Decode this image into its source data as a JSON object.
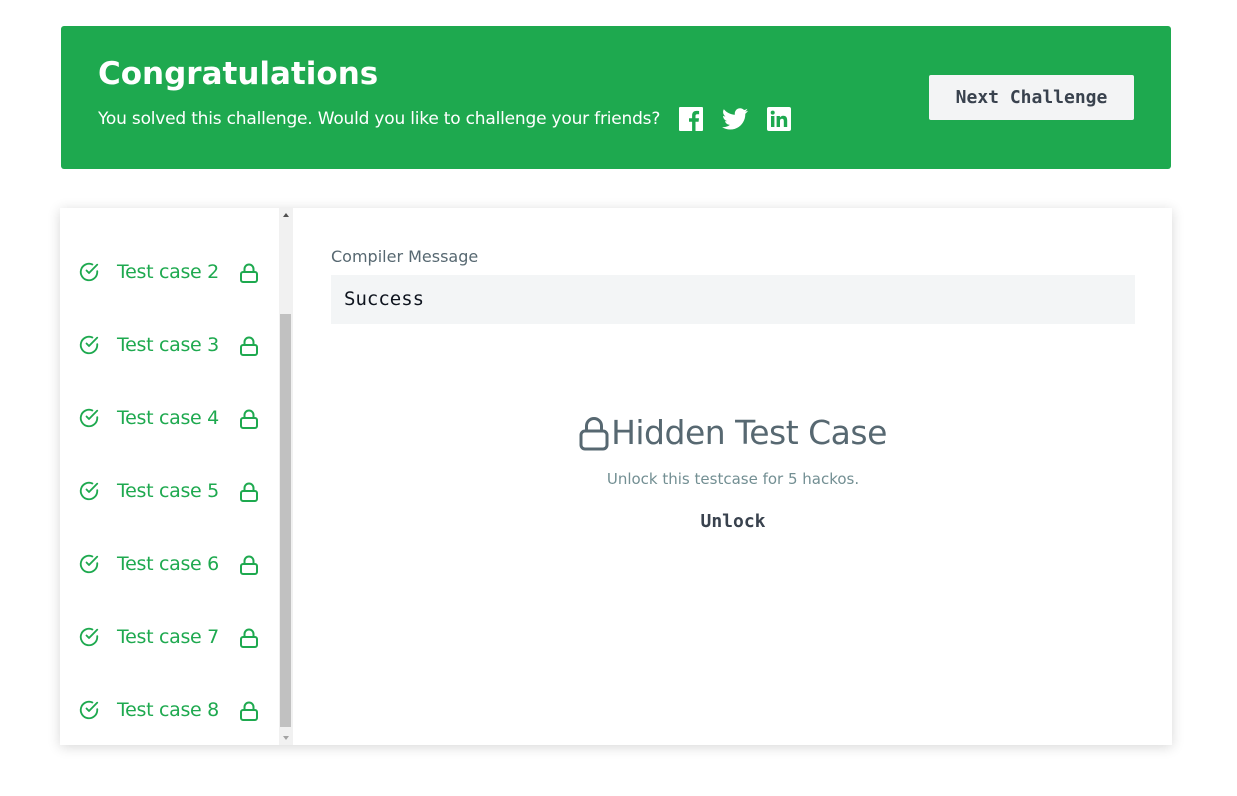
{
  "banner": {
    "title": "Congratulations",
    "subtitle": "You solved this challenge. Would you like to challenge your friends?",
    "share_icons": [
      "facebook-icon",
      "twitter-icon",
      "linkedin-icon"
    ],
    "next_button_label": "Next Challenge",
    "background_color": "#1ea94f"
  },
  "sidebar": {
    "items": [
      {
        "label": "Test case 2",
        "status": "passed",
        "locked": true
      },
      {
        "label": "Test case 3",
        "status": "passed",
        "locked": true
      },
      {
        "label": "Test case 4",
        "status": "passed",
        "locked": true
      },
      {
        "label": "Test case 5",
        "status": "passed",
        "locked": true
      },
      {
        "label": "Test case 6",
        "status": "passed",
        "locked": true
      },
      {
        "label": "Test case 7",
        "status": "passed",
        "locked": true
      },
      {
        "label": "Test case 8",
        "status": "passed",
        "locked": true
      }
    ],
    "accent_color": "#1ea94f"
  },
  "main": {
    "compiler_label": "Compiler Message",
    "compiler_message": "Success",
    "hidden_title": "Hidden Test Case",
    "hidden_subtitle": "Unlock this testcase for 5 hackos.",
    "unlock_label": "Unlock"
  }
}
